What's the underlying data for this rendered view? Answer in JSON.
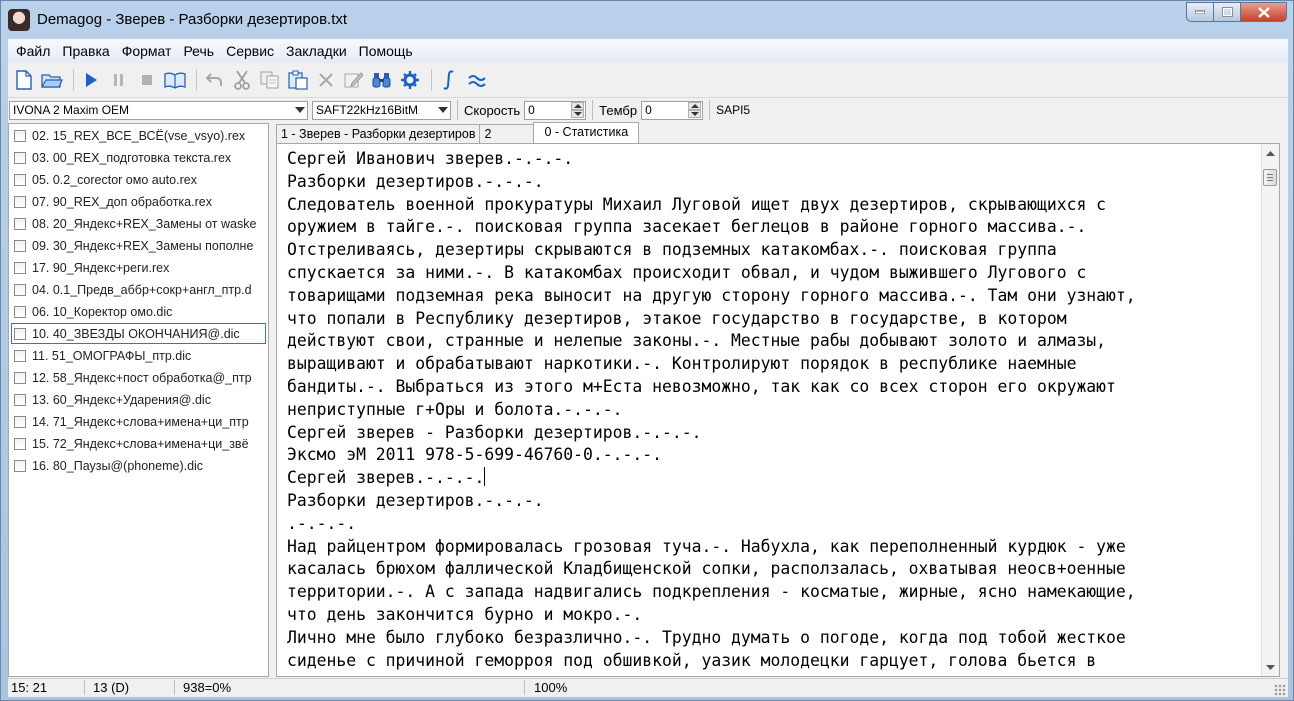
{
  "window": {
    "title": "Demagog - Зверев - Разборки дезертиров.txt"
  },
  "menu": [
    "Файл",
    "Правка",
    "Формат",
    "Речь",
    "Сервис",
    "Закладки",
    "Помощь"
  ],
  "voicebar": {
    "voice": "IVONA 2 Maxim OEM",
    "format": "SAFT22kHz16BitM",
    "speed_label": "Скорость",
    "speed_value": "0",
    "timbre_label": "Тембр",
    "timbre_value": "0",
    "engine": "SAPI5"
  },
  "files": [
    "02. 15_REX_ВСЕ_ВСЁ(vse_vsyo).rex",
    "03. 00_REX_подготовка текста.rex",
    "05. 0.2_corector омо auto.rex",
    "07. 90_REX_доп обработка.rex",
    "08. 20_Яндекс+REX_Замены от waske",
    "09. 30_Яндекс+REX_Замены пополне",
    "17. 90_Яндекс+реги.rex",
    "04. 0.1_Предв_аббр+сокр+англ_птр.d",
    "06. 10_Коректор омо.dic",
    "10. 40_ЗВЕЗДЫ ОКОНЧАНИЯ@.dic",
    "11. 51_ОМОГРАФЫ_птр.dic",
    "12. 58_Яндекс+пост обработка@_птр",
    "13. 60_Яндекс+Ударения@.dic",
    "14. 71_Яндекс+слова+имена+ци_птр",
    "15. 72_Яндекс+слова+имена+ци_звё",
    "16. 80_Паузы@(phoneme).dic"
  ],
  "selected_file": "10. 40_ЗВЕЗДЫ ОКОНЧАНИЯ@.dic",
  "tabs": [
    "1 - Зверев - Разборки дезертиров",
    "2",
    "0 - Статистика"
  ],
  "active_tab": "0 - Статистика",
  "editor": {
    "lines": [
      "Сергей Иванович зверев.-.-.-.",
      "Разборки дезертиров.-.-.-.",
      "Следователь военной прокуратуры Михаил Луговой ищет двух дезертиров, скрывающихся с",
      "оружием в тайге.-. поисковая группа засекает беглецов в районе горного массива.-.",
      "Отстреливаясь, дезертиры скрываются в подземных катакомбах.-. поисковая группа",
      "спускается за ними.-. В катакомбах происходит обвал, и чудом выжившего Лугового с",
      "товарищами подземная река выносит на другую сторону горного массива.-. Там они узнают,",
      "что попали в Республику дезертиров, этакое государство в государстве, в котором",
      "действуют свои, странные и нелепые законы.-. Местные рабы добывают золото и алмазы,",
      "выращивают и обрабатывают наркотики.-. Контролируют порядок в республике наемные",
      "бандиты.-. Выбраться из этого м+Еста невозможно, так как со всех сторон его окружают",
      "неприступные г+Оры и болота.-.-.-.",
      "Сергей зверев - Разборки дезертиров.-.-.-.",
      "Эксмо эМ 2011 978-5-699-46760-0.-.-.-.",
      "Сергей зверев.-.-.-.",
      "Разборки дезертиров.-.-.-.",
      ".-.-.-.",
      "Над райцентром формировалась грозовая туча.-. Набухла, как переполненный курдюк - уже",
      "касалась брюхом фаллической Кладбищенской сопки, расползалась, охватывая неосв+оенные",
      "территории.-. А с запада надвигались подкрепления - косматые, жирные, ясно намекающие,",
      "что день закончится бурно и мокро.-.",
      "Лично мне было глубоко безразлично.-. Трудно думать о погоде, когда под тобой жесткое",
      "сиденье с причиной геморроя под обшивкой, уазик молодецки гарцует, голова бьется в"
    ]
  },
  "status": {
    "position": "15: 21",
    "line_info": "13 (D)",
    "progress": "938=0%",
    "zoom": "100%"
  }
}
